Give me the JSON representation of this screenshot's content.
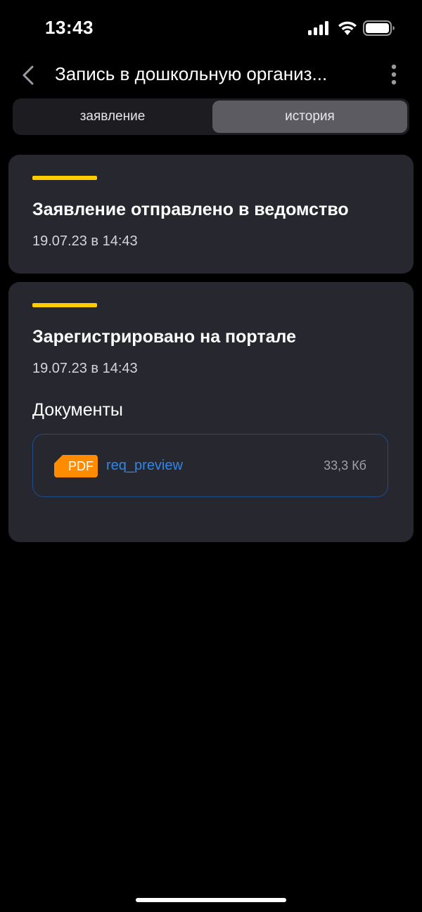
{
  "status_bar": {
    "time": "13:43"
  },
  "header": {
    "title": "Запись в дошкольную организ..."
  },
  "tabs": [
    {
      "label": "заявление",
      "active": false
    },
    {
      "label": "история",
      "active": true
    }
  ],
  "history": [
    {
      "title": "Заявление отправлено в ведомство",
      "date": "19.07.23 в 14:43"
    },
    {
      "title": "Зарегистрировано на портале",
      "date": "19.07.23 в 14:43",
      "documents_heading": "Документы",
      "documents": [
        {
          "type": "PDF",
          "name": "req_preview",
          "size": "33,3 Кб"
        }
      ]
    }
  ],
  "colors": {
    "background": "#000000",
    "card": "#27272f",
    "accent": "#ffcc00",
    "link": "#2f86e8",
    "pdf_badge": "#ff8c00"
  },
  "icons": [
    "signal-icon",
    "wifi-icon",
    "battery-icon",
    "back-icon",
    "more-icon",
    "pdf-icon"
  ]
}
